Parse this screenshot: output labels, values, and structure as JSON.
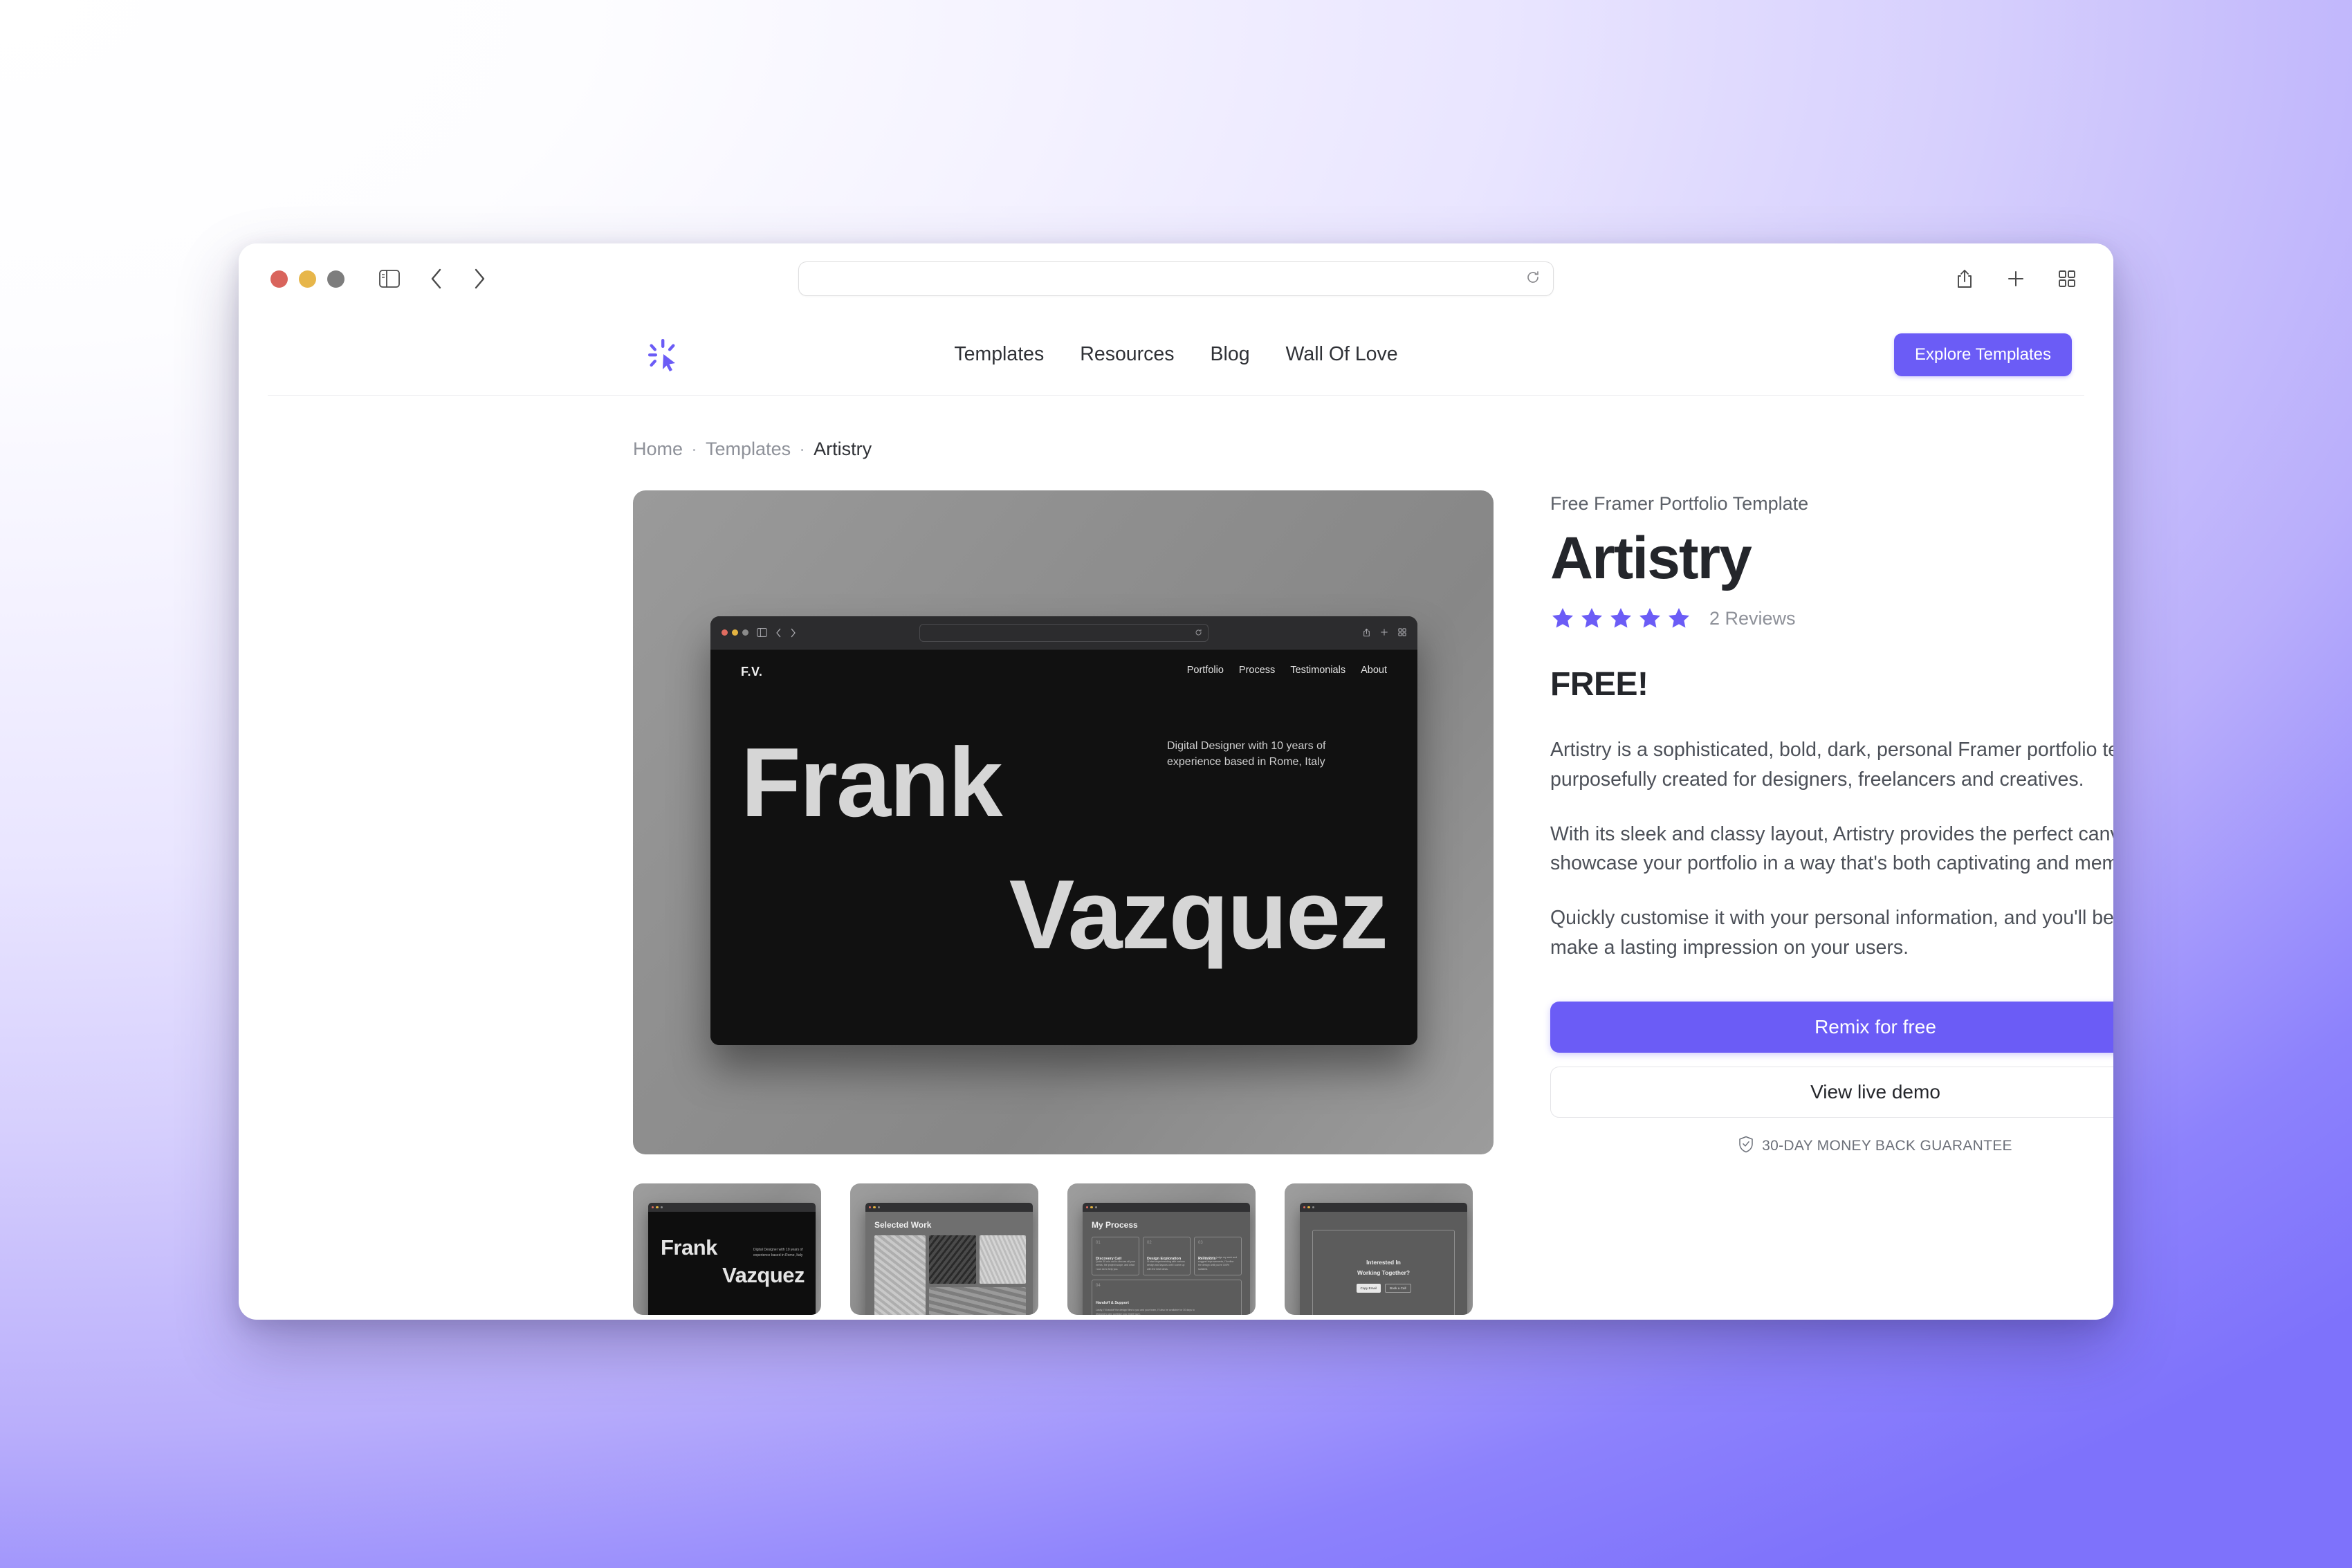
{
  "browser": {
    "url_value": "",
    "url_placeholder": "",
    "icons": {
      "sidebar": "sidebar-icon",
      "back": "back-arrow-icon",
      "forward": "forward-arrow-icon",
      "reload": "reload-icon",
      "share": "share-icon",
      "new_tab": "plus-icon",
      "tab_overview": "tab-grid-icon"
    }
  },
  "site_header": {
    "logo": "framer-sparkle-cursor-logo",
    "nav": [
      {
        "label": "Templates"
      },
      {
        "label": "Resources"
      },
      {
        "label": "Blog"
      },
      {
        "label": "Wall Of Love"
      }
    ],
    "cta_label": "Explore Templates",
    "cta_color": "#6B5CF6"
  },
  "breadcrumb": {
    "home": "Home",
    "sep1": "·",
    "templates": "Templates",
    "sep2": "·",
    "current": "Artistry"
  },
  "gallery": {
    "hero": {
      "mock_logo": "F.V.",
      "mock_nav": [
        {
          "label": "Portfolio"
        },
        {
          "label": "Process"
        },
        {
          "label": "Testimonials"
        },
        {
          "label": "About"
        }
      ],
      "headline_line1": "Frank",
      "headline_line2": "Vazquez",
      "tagline": "Digital Designer with 10 years of experience based in Rome, Italy"
    },
    "thumbnails": [
      {
        "name": "hero-thumbnail",
        "line1": "Frank",
        "line2": "Vazquez",
        "tagline": "Digital Designer with 10 years of experience based in Rome, Italy"
      },
      {
        "name": "selected-work-thumbnail",
        "title": "Selected Work"
      },
      {
        "name": "my-process-thumbnail",
        "title": "My Process",
        "steps": [
          {
            "num": "01",
            "title": "Discovery Call",
            "body": "Quick 30 min call to discuss all your needs, the project scope, and what I can do to help you."
          },
          {
            "num": "02",
            "title": "Design Exploration",
            "body": "I'll start experimenting with various design and layouts until I come up with the best ideas."
          },
          {
            "num": "03",
            "title": "Revisions",
            "body": "You'll be able to judge my work and suggest improvements, I'll refine the design until you're 100% satisfied."
          },
          {
            "num": "04",
            "title": "Handoff & Support",
            "body": "Lastly, I'll handoff the design files to you and your team, I'll also be available for 30 days to respond to any question you might have."
          }
        ]
      },
      {
        "name": "contact-cta-thumbnail",
        "line1": "Interested In",
        "line2": "Working Together?",
        "btn1": "Copy Email",
        "btn2": "Book a Call"
      }
    ]
  },
  "details": {
    "eyebrow": "Free Framer Portfolio Template",
    "title": "Artistry",
    "rating": {
      "stars_filled": 5,
      "stars_total": 5,
      "star_color": "#6B5CF6",
      "reviews_label": "2 Reviews"
    },
    "price": "FREE!",
    "paragraphs": [
      "Artistry is a sophisticated, bold, dark, personal Framer portfolio template purposefully created for designers, freelancers and creatives.",
      "With its sleek and classy layout, Artistry provides the perfect canvas to showcase your portfolio in a way that's both captivating and memorable.",
      "Quickly customise it with your personal information, and you'll be ready to make a lasting impression on your users."
    ],
    "primary_cta": "Remix for free",
    "secondary_cta": "View live demo",
    "guarantee": "30-DAY MONEY BACK GUARANTEE",
    "guarantee_icon": "shield-check-icon"
  }
}
